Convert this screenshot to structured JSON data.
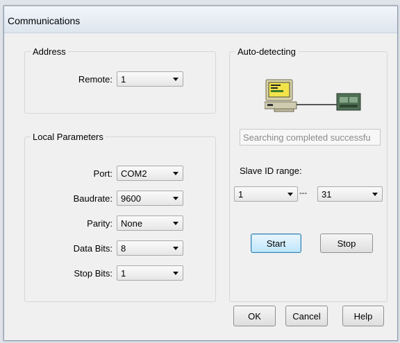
{
  "window": {
    "title": "Communications"
  },
  "address": {
    "group_label": "Address",
    "remote_label": "Remote:",
    "remote_value": "1"
  },
  "local": {
    "group_label": "Local Parameters",
    "port_label": "Port:",
    "port_value": "COM2",
    "baudrate_label": "Baudrate:",
    "baudrate_value": "9600",
    "parity_label": "Parity:",
    "parity_value": "None",
    "databits_label": "Data Bits:",
    "databits_value": "8",
    "stopbits_label": "Stop Bits:",
    "stopbits_value": "1"
  },
  "autodetect": {
    "group_label": "Auto-detecting",
    "status_text": "Searching completed successfu",
    "slave_range_label": "Slave ID range:",
    "range_from": "1",
    "range_separator": "---",
    "range_to": "31",
    "start_label": "Start",
    "stop_label": "Stop"
  },
  "buttons": {
    "ok": "OK",
    "cancel": "Cancel",
    "help": "Help"
  },
  "icons": {
    "computer": "computer-icon",
    "device": "plc-device-icon"
  }
}
